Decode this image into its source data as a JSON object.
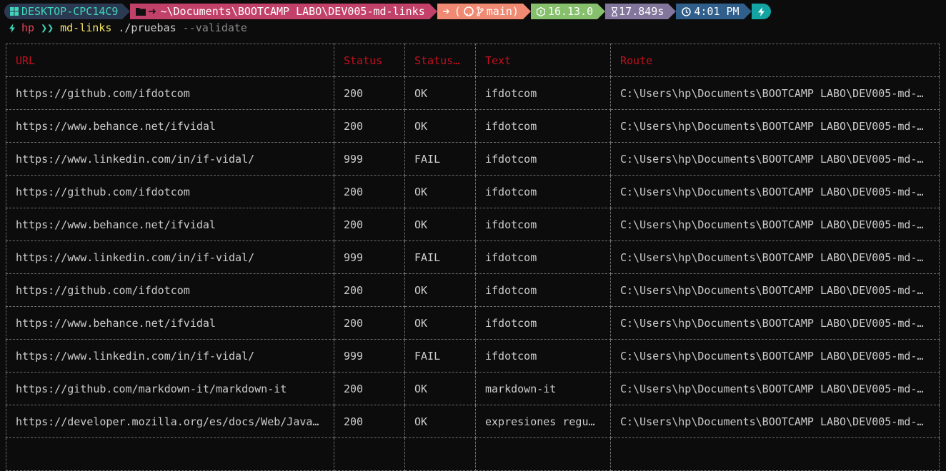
{
  "prompt": {
    "machine": "DESKTOP-CPC14C9",
    "path": "~\\Documents\\BOOTCAMP LABO\\DEV005-md-links",
    "git": "main",
    "node_version": "16.13.0",
    "duration": "17.849s",
    "time": "4:01 PM",
    "colors": {
      "machine_bg": "#2b3a52",
      "machine_fg": "#3fd6b8",
      "path_bg": "#c2416b",
      "git_bg": "#f08a72",
      "node_bg": "#86c06c",
      "duration_bg": "#83769c",
      "time_bg": "#2f5f8a",
      "end_bg": "#13a3a3"
    }
  },
  "command": {
    "user": "hp",
    "arrows": "❯❯",
    "name": "md-links",
    "arg": "./pruebas",
    "flag": "--validate"
  },
  "table": {
    "headers": [
      "URL",
      "Status",
      "Status …",
      "Text",
      "Route"
    ],
    "rows": [
      [
        "https://github.com/ifdotcom",
        "200",
        "OK",
        "ifdotcom",
        "C:\\Users\\hp\\Documents\\BOOTCAMP LABO\\DEV005-md-l…"
      ],
      [
        "https://www.behance.net/ifvidal",
        "200",
        "OK",
        "ifdotcom",
        "C:\\Users\\hp\\Documents\\BOOTCAMP LABO\\DEV005-md-l…"
      ],
      [
        "https://www.linkedin.com/in/if-vidal/",
        "999",
        "FAIL",
        "ifdotcom",
        "C:\\Users\\hp\\Documents\\BOOTCAMP LABO\\DEV005-md-l…"
      ],
      [
        "https://github.com/ifdotcom",
        "200",
        "OK",
        "ifdotcom",
        "C:\\Users\\hp\\Documents\\BOOTCAMP LABO\\DEV005-md-l…"
      ],
      [
        "https://www.behance.net/ifvidal",
        "200",
        "OK",
        "ifdotcom",
        "C:\\Users\\hp\\Documents\\BOOTCAMP LABO\\DEV005-md-l…"
      ],
      [
        "https://www.linkedin.com/in/if-vidal/",
        "999",
        "FAIL",
        "ifdotcom",
        "C:\\Users\\hp\\Documents\\BOOTCAMP LABO\\DEV005-md-l…"
      ],
      [
        "https://github.com/ifdotcom",
        "200",
        "OK",
        "ifdotcom",
        "C:\\Users\\hp\\Documents\\BOOTCAMP LABO\\DEV005-md-l…"
      ],
      [
        "https://www.behance.net/ifvidal",
        "200",
        "OK",
        "ifdotcom",
        "C:\\Users\\hp\\Documents\\BOOTCAMP LABO\\DEV005-md-l…"
      ],
      [
        "https://www.linkedin.com/in/if-vidal/",
        "999",
        "FAIL",
        "ifdotcom",
        "C:\\Users\\hp\\Documents\\BOOTCAMP LABO\\DEV005-md-l…"
      ],
      [
        "https://github.com/markdown-it/markdown-it",
        "200",
        "OK",
        "markdown-it",
        "C:\\Users\\hp\\Documents\\BOOTCAMP LABO\\DEV005-md-l…"
      ],
      [
        "https://developer.mozilla.org/es/docs/Web/JavaS…",
        "200",
        "OK",
        "expresiones regul…",
        "C:\\Users\\hp\\Documents\\BOOTCAMP LABO\\DEV005-md-l…"
      ],
      [
        "",
        "",
        "",
        "",
        ""
      ]
    ]
  }
}
